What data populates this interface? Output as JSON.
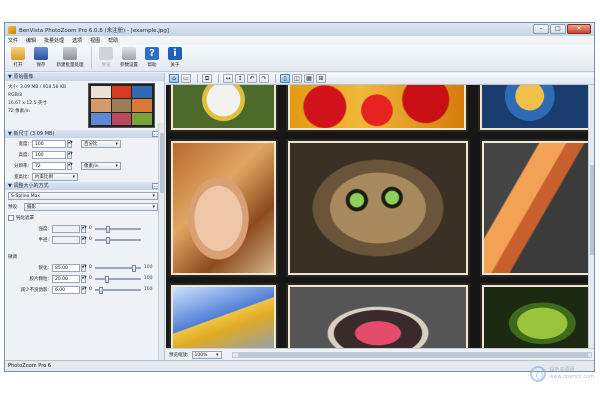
{
  "window": {
    "title": "BenVista PhotoZoom Pro 6.0.8 (未注册) - [example.jpg]",
    "controls": [
      "–",
      "□",
      "✕"
    ]
  },
  "menu": [
    "文件",
    "编辑",
    "批量处理",
    "选项",
    "视图",
    "帮助"
  ],
  "toolbar": {
    "open": "打开",
    "save": "保存",
    "batch": "新建批量处理",
    "preview": "预览",
    "settings": "参数设置",
    "help": "帮助",
    "about": "关于"
  },
  "source": {
    "section": "原始图像",
    "size": "大小: 3.09 MB / 918.58 KB",
    "color": "RGB/8",
    "dims": "16.67 x 12.5 英寸",
    "dpi": "72 像素/in"
  },
  "new_size": {
    "section": "新尺寸 (3.09 MB)",
    "width_label": "宽度:",
    "width_value": "100",
    "width_unit": "百分比",
    "height_label": "高度:",
    "height_value": "100",
    "res_label": "分辨率:",
    "res_value": "72",
    "res_unit": "像素/in",
    "fit_label": "宽高比:",
    "fit_value": "约束比例"
  },
  "method": {
    "section": "调整大小的方式",
    "algorithm": "S-Spline Max",
    "preset_label": "预设:",
    "preset_value": "摄影",
    "unsharp_label": "钝化遮罩",
    "intensity_label": "强度:",
    "radius_label": "半径:",
    "min": "0",
    "max": "100"
  },
  "tuning": {
    "label": "微调",
    "sharpness_label": "锐化:",
    "sharpness_value": "85.00",
    "film_grain_label": "胶片颗粒:",
    "film_grain_value": "20.00",
    "artifact_label": "减少不良伪影:",
    "artifact_value": "6.00",
    "min": "0",
    "max": "100"
  },
  "viewer": {
    "zoom_label": "预览缩放:",
    "zoom_value": "100%"
  },
  "statusbar": "PhotoZoom Pro 6",
  "watermark": {
    "line1": "绿色资源网",
    "line2": "www.downcc.com"
  },
  "colors": {
    "accent": "#2e6fcd",
    "window_border": "#7a8ea8",
    "viewer_bg": "#161616"
  }
}
